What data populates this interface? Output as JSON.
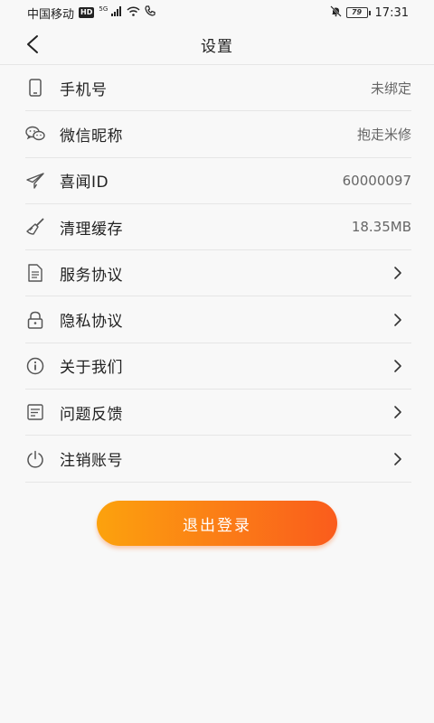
{
  "status_bar": {
    "carrier": "中国移动",
    "hd": "HD",
    "network": "5G",
    "battery": "79",
    "time": "17:31"
  },
  "header": {
    "title": "设置"
  },
  "settings": [
    {
      "icon": "phone-icon",
      "label": "手机号",
      "value": "未绑定"
    },
    {
      "icon": "wechat-icon",
      "label": "微信昵称",
      "value": "抱走米修"
    },
    {
      "icon": "paper-plane-icon",
      "label": "喜闻ID",
      "value": "60000097"
    },
    {
      "icon": "broom-icon",
      "label": "清理缓存",
      "value": "18.35MB"
    },
    {
      "icon": "document-icon",
      "label": "服务协议"
    },
    {
      "icon": "lock-icon",
      "label": "隐私协议"
    },
    {
      "icon": "info-icon",
      "label": "关于我们"
    },
    {
      "icon": "feedback-icon",
      "label": "问题反馈"
    },
    {
      "icon": "power-icon",
      "label": "注销账号"
    }
  ],
  "logout": {
    "label": "退出登录"
  },
  "colors": {
    "accent_start": "#fca20d",
    "accent_end": "#fa5c1c",
    "background": "#f8f8f8",
    "divider": "#e6e6e6"
  }
}
